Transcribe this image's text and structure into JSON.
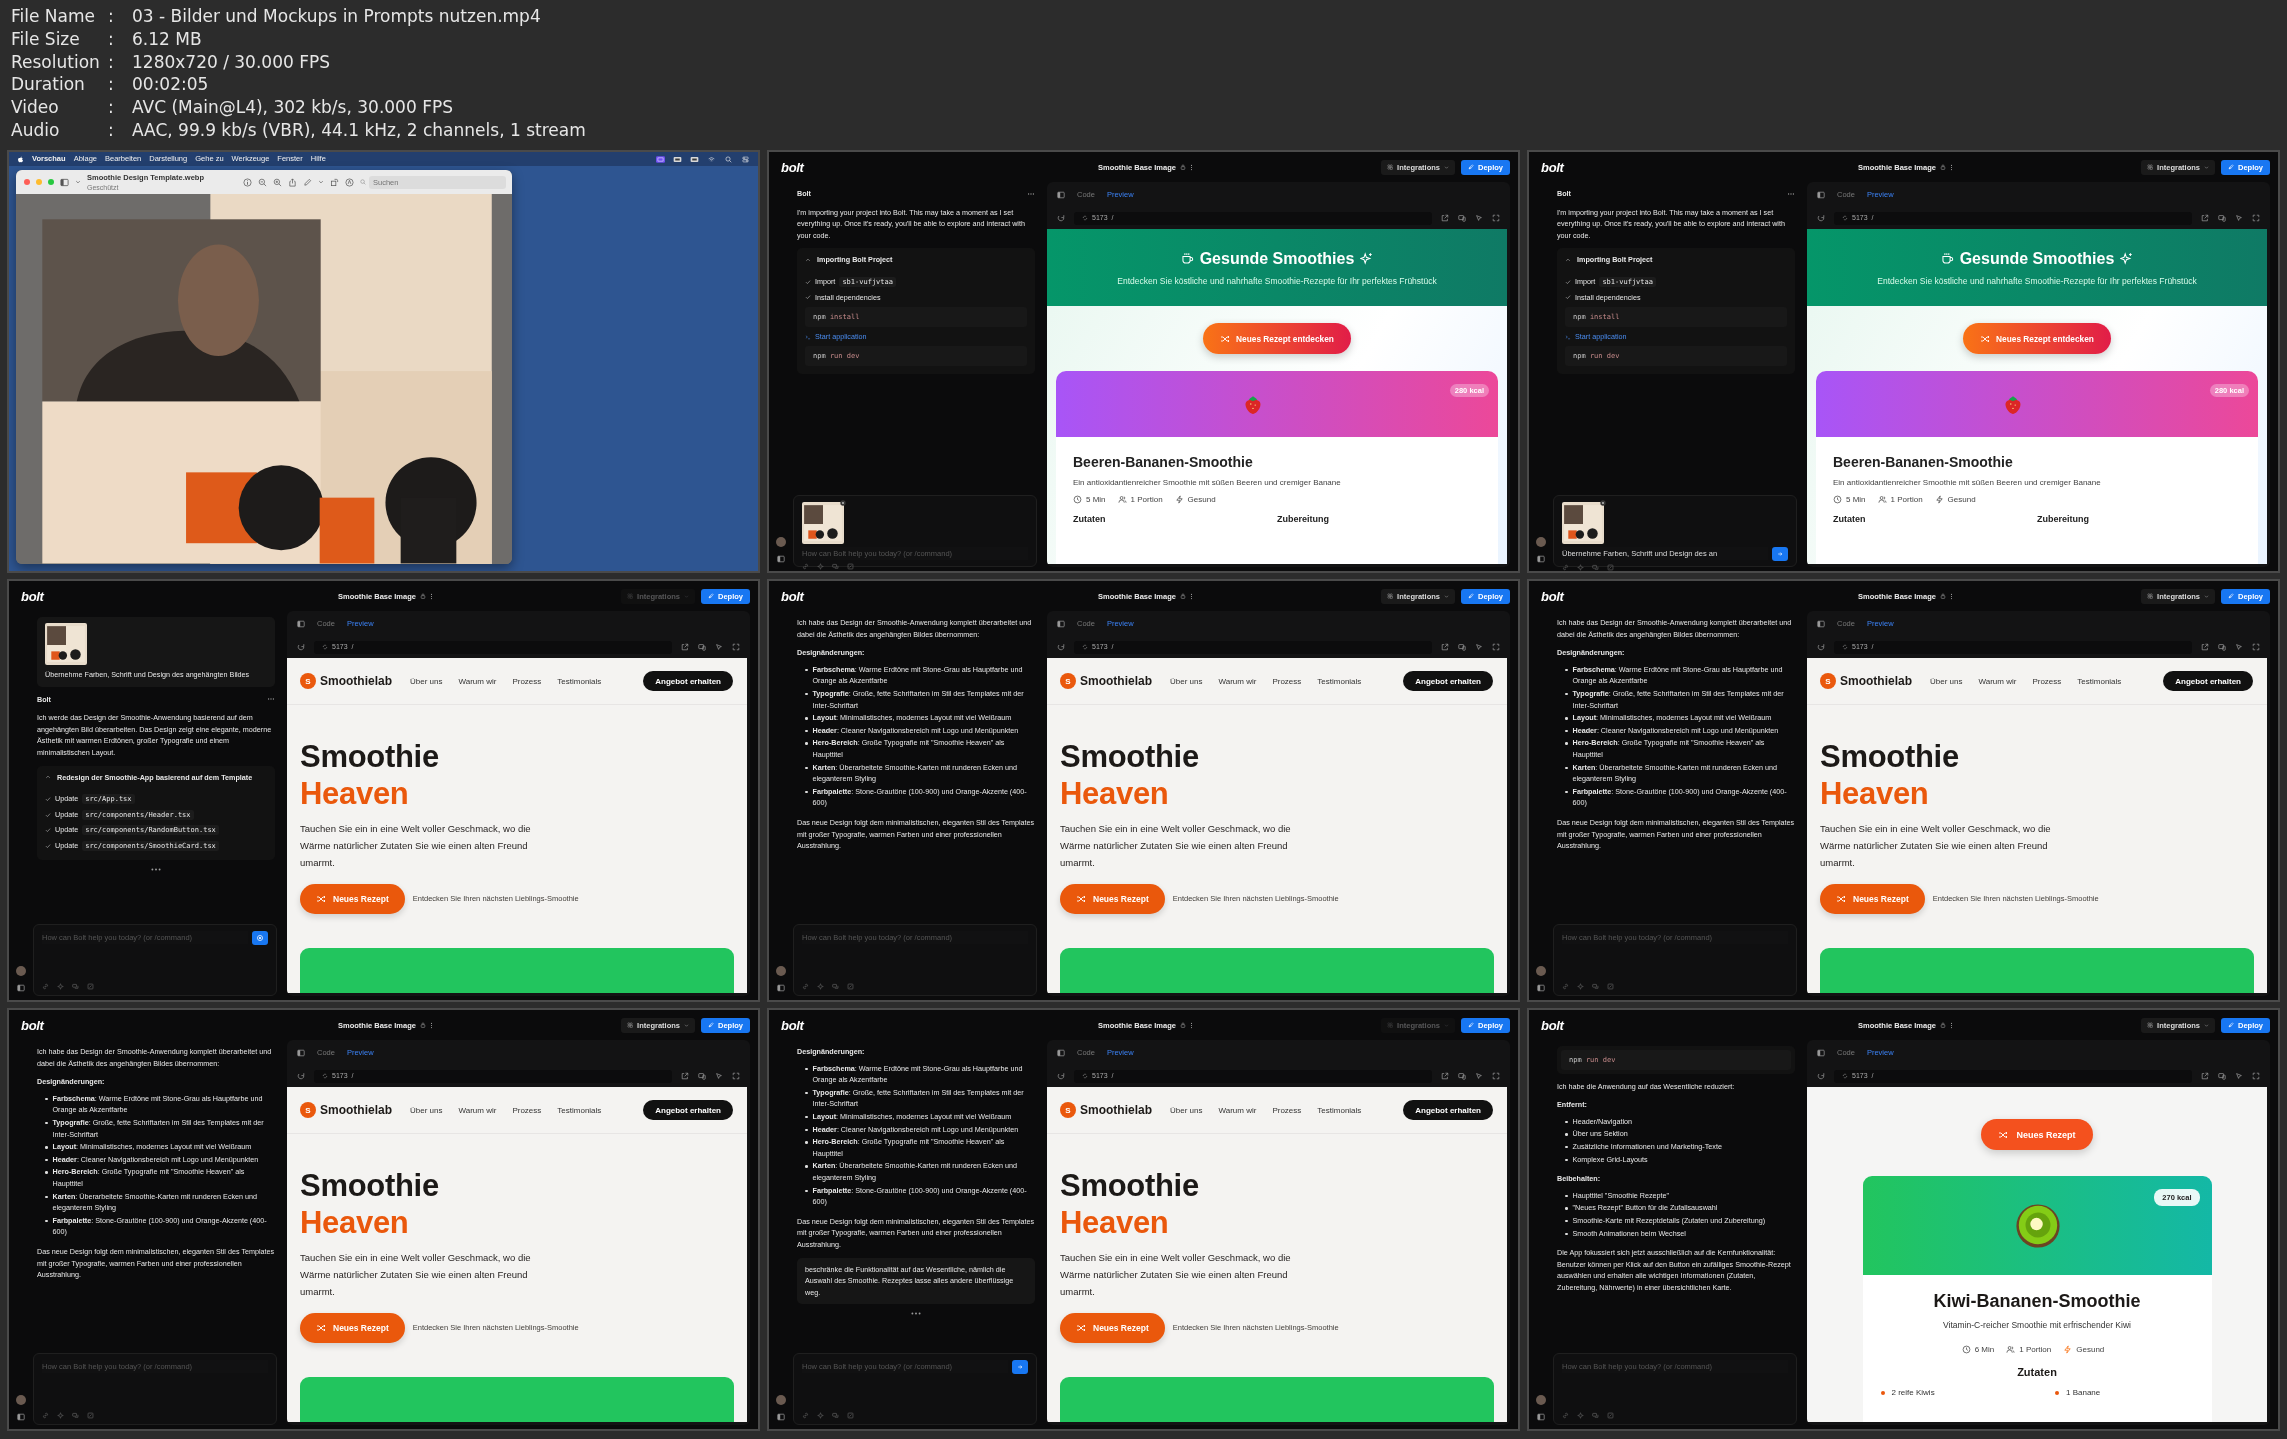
{
  "file_info": [
    {
      "label": "File Name",
      "separator": ":",
      "value": "03 - Bilder und Mockups in Prompts nutzen.mp4"
    },
    {
      "label": "File Size",
      "separator": ":",
      "value": "6.12 MB"
    },
    {
      "label": "Resolution",
      "separator": ":",
      "value": "1280x720 / 30.000 FPS"
    },
    {
      "label": "Duration",
      "separator": ":",
      "value": "00:02:05"
    },
    {
      "label": "Video",
      "separator": ":",
      "value": "AVC (Main@L4), 302 kb/s, 30.000 FPS"
    },
    {
      "label": "Audio",
      "separator": ":",
      "value": "AAC, 99.9 kb/s (VBR), 44.1 kHz, 2 channels, 1 stream"
    }
  ],
  "frames": [
    {
      "kind": "preview_app",
      "menu_bar": {
        "app": "Vorschau",
        "items": [
          "Ablage",
          "Bearbeiten",
          "Darstellung",
          "Gehe zu",
          "Werkzeuge",
          "Fenster",
          "Hilfe"
        ]
      },
      "window": {
        "title": "Smoothie Design Template.webp",
        "subtitle": "Geschützt",
        "search_placeholder": "Suchen"
      }
    },
    {
      "kind": "bolt",
      "logo": "bolt",
      "project_title": "Smoothie Base Image",
      "integrations": {
        "label": "Integrations",
        "disabled": false
      },
      "deploy": "Deploy",
      "tabs": [
        {
          "label": "Code",
          "selected": false
        },
        {
          "label": "Preview",
          "selected": true
        }
      ],
      "port": "5173",
      "path": "/",
      "chat": [
        {
          "kind": "sender",
          "name": "Bolt"
        },
        {
          "kind": "text",
          "text": "I'm importing your project into Bolt. This may take a moment as I set everything up. Once it's ready, you'll be able to explore and interact with your code."
        },
        {
          "kind": "task",
          "title": "Importing Bolt Project",
          "expanded": true,
          "steps": [
            {
              "kind": "check",
              "label": "Import",
              "code": "sb1-vufjvtaa"
            },
            {
              "kind": "check",
              "label": "Install dependencies"
            },
            {
              "kind": "command",
              "program": "npm",
              "args": "install"
            },
            {
              "kind": "start",
              "label": "Start application"
            },
            {
              "kind": "command",
              "program": "npm",
              "args": "run dev"
            }
          ]
        }
      ],
      "input": {
        "attachment": true,
        "placeholder": "How can Bolt help you today? (or /command)"
      },
      "preview": {
        "kind": "gesunde",
        "title": "Gesunde Smoothies",
        "subtitle": "Entdecken Sie köstliche und nahrhafte Smoothie-Rezepte für Ihr perfektes Frühstück",
        "button": "Neues Rezept entdecken",
        "card": {
          "kcal": "280 kcal",
          "name": "Beeren-Bananen-Smoothie",
          "description": "Ein antioxidantienreicher Smoothie mit süßen Beeren und cremiger Banane",
          "meta": [
            "5 Min",
            "1 Portion",
            "Gesund"
          ],
          "sections": [
            "Zutaten",
            "Zubereitung"
          ]
        }
      }
    },
    {
      "kind": "bolt",
      "logo": "bolt",
      "project_title": "Smoothie Base Image",
      "integrations": {
        "label": "Integrations",
        "disabled": false
      },
      "deploy": "Deploy",
      "tabs": [
        {
          "label": "Code",
          "selected": false
        },
        {
          "label": "Preview",
          "selected": true
        }
      ],
      "port": "5173",
      "path": "/",
      "chat": [
        {
          "kind": "sender",
          "name": "Bolt"
        },
        {
          "kind": "text",
          "text": "I'm importing your project into Bolt. This may take a moment as I set everything up. Once it's ready, you'll be able to explore and interact with your code."
        },
        {
          "kind": "task",
          "title": "Importing Bolt Project",
          "expanded": true,
          "steps": [
            {
              "kind": "check",
              "label": "Import",
              "code": "sb1-vufjvtaa"
            },
            {
              "kind": "check",
              "label": "Install dependencies"
            },
            {
              "kind": "command",
              "program": "npm",
              "args": "install"
            },
            {
              "kind": "start",
              "label": "Start application"
            },
            {
              "kind": "command",
              "program": "npm",
              "args": "run dev"
            }
          ]
        }
      ],
      "input": {
        "attachment": true,
        "value": "Übernehme Farben, Schrift und Design des an",
        "button": {
          "kind": "send"
        }
      },
      "preview": {
        "kind": "gesunde",
        "title": "Gesunde Smoothies",
        "subtitle": "Entdecken Sie köstliche und nahrhafte Smoothie-Rezepte für Ihr perfektes Frühstück",
        "button": "Neues Rezept entdecken",
        "card": {
          "kcal": "280 kcal",
          "name": "Beeren-Bananen-Smoothie",
          "description": "Ein antioxidantienreicher Smoothie mit süßen Beeren und cremiger Banane",
          "meta": [
            "5 Min",
            "1 Portion",
            "Gesund"
          ],
          "sections": [
            "Zutaten",
            "Zubereitung"
          ]
        }
      }
    },
    {
      "kind": "bolt",
      "logo": "bolt",
      "project_title": "Smoothie Base Image",
      "integrations": {
        "label": "Integrations",
        "disabled": true
      },
      "deploy": "Deploy",
      "tabs": [
        {
          "label": "Code",
          "selected": false
        },
        {
          "label": "Preview",
          "selected": true
        }
      ],
      "port": "5173",
      "path": "/",
      "chat": [
        {
          "kind": "user",
          "attachment": true,
          "text": "Übernehme Farben, Schrift und Design des angehängten Bildes"
        },
        {
          "kind": "sender",
          "name": "Bolt"
        },
        {
          "kind": "text",
          "text": "Ich werde das Design der Smoothie-Anwendung basierend auf dem angehängten Bild überarbeiten. Das Design zeigt eine elegante, moderne Ästhetik mit warmen Erdtönen, großer Typografie und einem minimalistischen Layout."
        },
        {
          "kind": "task",
          "title": "Redesign der Smoothie-App basierend auf dem Template",
          "expanded": true,
          "steps": [
            {
              "kind": "check",
              "label": "Update",
              "code": "src/App.tsx"
            },
            {
              "kind": "check",
              "label": "Update",
              "code": "src/components/Header.tsx"
            },
            {
              "kind": "check",
              "label": "Update",
              "code": "src/components/RandomButton.tsx"
            },
            {
              "kind": "check",
              "label": "Update",
              "code": "src/components/SmoothieCard.tsx"
            }
          ]
        },
        {
          "kind": "loading"
        }
      ],
      "input": {
        "attachment": false,
        "placeholder": "How can Bolt help you today? (or /command)",
        "button": {
          "kind": "stop"
        }
      },
      "preview": {
        "kind": "smoothielab",
        "logo_letter": "S",
        "brand": "Smoothielab",
        "nav": [
          "Über uns",
          "Warum wir",
          "Prozess",
          "Testimonials"
        ],
        "cta": "Angebot erhalten",
        "headline": [
          "Smoothie",
          "Heaven"
        ],
        "text": "Tauchen Sie ein in eine Welt voller Geschmack, wo die Wärme natürlicher Zutaten Sie wie einen alten Freund umarmt.",
        "button": "Neues Rezept",
        "hint": "Entdecken Sie Ihren nächsten Lieblings-Smoothie"
      }
    },
    {
      "kind": "bolt",
      "logo": "bolt",
      "project_title": "Smoothie Base Image",
      "integrations": {
        "label": "Integrations",
        "disabled": false
      },
      "deploy": "Deploy",
      "tabs": [
        {
          "label": "Code",
          "selected": false
        },
        {
          "label": "Preview",
          "selected": true
        }
      ],
      "port": "5173",
      "path": "/",
      "chat": [
        {
          "kind": "text",
          "text": "Ich habe das Design der Smoothie-Anwendung komplett überarbeitet und dabei die Ästhetik des angehängten Bildes übernommen:"
        },
        {
          "kind": "heading",
          "text": "Designänderungen:"
        },
        {
          "kind": "bullets",
          "items": [
            "**Farbschema**: Warme Erdtöne mit Stone-Grau als Hauptfarbe und Orange als Akzentfarbe",
            "**Typografie**: Große, fette Schriftarten im Stil des Templates mit der Inter-Schriftart",
            "**Layout**: Minimalistisches, modernes Layout mit viel Weißraum",
            "**Header**: Cleaner Navigationsbereich mit Logo und Menüpunkten",
            "**Hero-Bereich**: Große Typografie mit \"Smoothie Heaven\" als Haupttitel",
            "**Karten**: Überarbeitete Smoothie-Karten mit runderen Ecken und eleganterem Styling",
            "**Farbpalette**: Stone-Grautöne (100-900) und Orange-Akzente (400-600)"
          ]
        },
        {
          "kind": "text",
          "text": "Das neue Design folgt dem minimalistischen, eleganten Stil des Templates mit großer Typografie, warmen Farben und einer professionellen Ausstrahlung."
        }
      ],
      "input": {
        "attachment": false,
        "placeholder": "How can Bolt help you today? (or /command)"
      },
      "preview": {
        "kind": "smoothielab",
        "logo_letter": "S",
        "brand": "Smoothielab",
        "nav": [
          "Über uns",
          "Warum wir",
          "Prozess",
          "Testimonials"
        ],
        "cta": "Angebot erhalten",
        "headline": [
          "Smoothie",
          "Heaven"
        ],
        "text": "Tauchen Sie ein in eine Welt voller Geschmack, wo die Wärme natürlicher Zutaten Sie wie einen alten Freund umarmt.",
        "button": "Neues Rezept",
        "hint": "Entdecken Sie Ihren nächsten Lieblings-Smoothie"
      }
    },
    {
      "kind": "bolt",
      "logo": "bolt",
      "project_title": "Smoothie Base Image",
      "integrations": {
        "label": "Integrations",
        "disabled": false
      },
      "deploy": "Deploy",
      "tabs": [
        {
          "label": "Code",
          "selected": false
        },
        {
          "label": "Preview",
          "selected": true
        }
      ],
      "port": "5173",
      "path": "/",
      "chat": [
        {
          "kind": "text",
          "text": "Ich habe das Design der Smoothie-Anwendung komplett überarbeitet und dabei die Ästhetik des angehängten Bildes übernommen:"
        },
        {
          "kind": "heading",
          "text": "Designänderungen:"
        },
        {
          "kind": "bullets",
          "items": [
            "**Farbschema**: Warme Erdtöne mit Stone-Grau als Hauptfarbe und Orange als Akzentfarbe",
            "**Typografie**: Große, fette Schriftarten im Stil des Templates mit der Inter-Schriftart",
            "**Layout**: Minimalistisches, modernes Layout mit viel Weißraum",
            "**Header**: Cleaner Navigationsbereich mit Logo und Menüpunkten",
            "**Hero-Bereich**: Große Typografie mit \"Smoothie Heaven\" als Haupttitel",
            "**Karten**: Überarbeitete Smoothie-Karten mit runderen Ecken und eleganterem Styling",
            "**Farbpalette**: Stone-Grautöne (100-900) und Orange-Akzente (400-600)"
          ]
        },
        {
          "kind": "text",
          "text": "Das neue Design folgt dem minimalistischen, eleganten Stil des Templates mit großer Typografie, warmen Farben und einer professionellen Ausstrahlung."
        }
      ],
      "input": {
        "attachment": false,
        "placeholder": "How can Bolt help you today? (or /command)"
      },
      "preview": {
        "kind": "smoothielab",
        "logo_letter": "S",
        "brand": "Smoothielab",
        "nav": [
          "Über uns",
          "Warum wir",
          "Prozess",
          "Testimonials"
        ],
        "cta": "Angebot erhalten",
        "headline": [
          "Smoothie",
          "Heaven"
        ],
        "text": "Tauchen Sie ein in eine Welt voller Geschmack, wo die Wärme natürlicher Zutaten Sie wie einen alten Freund umarmt.",
        "button": "Neues Rezept",
        "hint": "Entdecken Sie Ihren nächsten Lieblings-Smoothie"
      }
    },
    {
      "kind": "bolt",
      "logo": "bolt",
      "project_title": "Smoothie Base Image",
      "integrations": {
        "label": "Integrations",
        "disabled": false
      },
      "deploy": "Deploy",
      "tabs": [
        {
          "label": "Code",
          "selected": false
        },
        {
          "label": "Preview",
          "selected": true
        }
      ],
      "port": "5173",
      "path": "/",
      "chat": [
        {
          "kind": "text",
          "text": "Ich habe das Design der Smoothie-Anwendung komplett überarbeitet und dabei die Ästhetik des angehängten Bildes übernommen:"
        },
        {
          "kind": "heading",
          "text": "Designänderungen:"
        },
        {
          "kind": "bullets",
          "items": [
            "**Farbschema**: Warme Erdtöne mit Stone-Grau als Hauptfarbe und Orange als Akzentfarbe",
            "**Typografie**: Große, fette Schriftarten im Stil des Templates mit der Inter-Schriftart",
            "**Layout**: Minimalistisches, modernes Layout mit viel Weißraum",
            "**Header**: Cleaner Navigationsbereich mit Logo und Menüpunkten",
            "**Hero-Bereich**: Große Typografie mit \"Smoothie Heaven\" als Haupttitel",
            "**Karten**: Überarbeitete Smoothie-Karten mit runderen Ecken und eleganterem Styling",
            "**Farbpalette**: Stone-Grautöne (100-900) und Orange-Akzente (400-600)"
          ]
        },
        {
          "kind": "text",
          "text": "Das neue Design folgt dem minimalistischen, eleganten Stil des Templates mit großer Typografie, warmen Farben und einer professionellen Ausstrahlung."
        }
      ],
      "input": {
        "attachment": false,
        "placeholder": "How can Bolt help you today? (or /command)"
      },
      "preview": {
        "kind": "smoothielab",
        "logo_letter": "S",
        "brand": "Smoothielab",
        "nav": [
          "Über uns",
          "Warum wir",
          "Prozess",
          "Testimonials"
        ],
        "cta": "Angebot erhalten",
        "headline": [
          "Smoothie",
          "Heaven"
        ],
        "text": "Tauchen Sie ein in eine Welt voller Geschmack, wo die Wärme natürlicher Zutaten Sie wie einen alten Freund umarmt.",
        "button": "Neues Rezept",
        "hint": "Entdecken Sie Ihren nächsten Lieblings-Smoothie"
      }
    },
    {
      "kind": "bolt",
      "logo": "bolt",
      "project_title": "Smoothie Base Image",
      "integrations": {
        "label": "Integrations",
        "disabled": true
      },
      "deploy": "Deploy",
      "tabs": [
        {
          "label": "Code",
          "selected": false
        },
        {
          "label": "Preview",
          "selected": true
        }
      ],
      "port": "5173",
      "path": "/",
      "chat": [
        {
          "kind": "heading",
          "text": "Designänderungen:"
        },
        {
          "kind": "bullets",
          "items": [
            "**Farbschema**: Warme Erdtöne mit Stone-Grau als Hauptfarbe und Orange als Akzentfarbe",
            "**Typografie**: Große, fette Schriftarten im Stil des Templates mit der Inter-Schriftart",
            "**Layout**: Minimalistisches, modernes Layout mit viel Weißraum",
            "**Header**: Cleaner Navigationsbereich mit Logo und Menüpunkten",
            "**Hero-Bereich**: Große Typografie mit \"Smoothie Heaven\" als Haupttitel",
            "**Karten**: Überarbeitete Smoothie-Karten mit runderen Ecken und eleganterem Styling",
            "**Farbpalette**: Stone-Grautöne (100-900) und Orange-Akzente (400-600)"
          ]
        },
        {
          "kind": "text",
          "text": "Das neue Design folgt dem minimalistischen, eleganten Stil des Templates mit großer Typografie, warmen Farben und einer professionellen Ausstrahlung."
        },
        {
          "kind": "user",
          "attachment": false,
          "text": "beschränke die Funktionalität auf das Wesentliche, nämlich die Auswahl des Smoothie. Rezeptes lasse alles andere überflüssige weg."
        },
        {
          "kind": "loading"
        }
      ],
      "input": {
        "attachment": false,
        "placeholder": "How can Bolt help you today? (or /command)",
        "button": {
          "kind": "send"
        }
      },
      "preview": {
        "kind": "smoothielab",
        "logo_letter": "S",
        "brand": "Smoothielab",
        "nav": [
          "Über uns",
          "Warum wir",
          "Prozess",
          "Testimonials"
        ],
        "cta": "Angebot erhalten",
        "headline": [
          "Smoothie",
          "Heaven"
        ],
        "text": "Tauchen Sie ein in eine Welt voller Geschmack, wo die Wärme natürlicher Zutaten Sie wie einen alten Freund umarmt.",
        "button": "Neues Rezept",
        "hint": "Entdecken Sie Ihren nächsten Lieblings-Smoothie"
      }
    },
    {
      "kind": "bolt",
      "logo": "bolt",
      "project_title": "Smoothie Base Image",
      "integrations": {
        "label": "Integrations",
        "disabled": false
      },
      "deploy": "Deploy",
      "tabs": [
        {
          "label": "Code",
          "selected": false
        },
        {
          "label": "Preview",
          "selected": true
        }
      ],
      "port": "5173",
      "path": "/",
      "chat": [
        {
          "kind": "task",
          "steps": [
            {
              "kind": "command",
              "program": "npm",
              "args": "run dev"
            }
          ]
        },
        {
          "kind": "text",
          "text": "Ich habe die Anwendung auf das Wesentliche reduziert:"
        },
        {
          "kind": "heading",
          "text": "Entfernt:"
        },
        {
          "kind": "bullets",
          "items": [
            "Header/Navigation",
            "Über uns Sektion",
            "Zusätzliche Informationen und Marketing-Texte",
            "Komplexe Grid-Layouts"
          ]
        },
        {
          "kind": "heading",
          "text": "Beibehalten:"
        },
        {
          "kind": "bullets",
          "items": [
            "Haupttitel \"Smoothie Rezepte\"",
            "\"Neues Rezept\" Button für die Zufallsauswahl",
            "Smoothie-Karte mit Rezeptdetails (Zutaten und Zubereitung)",
            "Smooth Animationen beim Wechsel"
          ]
        },
        {
          "kind": "text",
          "text": "Die App fokussiert sich jetzt ausschließlich auf die Kernfunktionalität: Benutzer können per Klick auf den Button ein zufälliges Smoothie-Rezept auswählen und erhalten alle wichtigen Informationen (Zutaten, Zubereitung, Nährwerte) in einer übersichtlichen Karte."
        }
      ],
      "input": {
        "attachment": false,
        "placeholder": "How can Bolt help you today? (or /command)"
      },
      "preview": {
        "kind": "kiwi",
        "button": "Neues Rezept",
        "card": {
          "kcal": "270 kcal",
          "name": "Kiwi-Bananen-Smoothie",
          "description": "Vitamin-C-reicher Smoothie mit erfrischender Kiwi",
          "meta": [
            "6 Min",
            "1 Portion",
            "Gesund"
          ],
          "section": "Zutaten",
          "ingredients": [
            "2 reife Kiwis",
            "1 Banane"
          ]
        }
      }
    }
  ]
}
